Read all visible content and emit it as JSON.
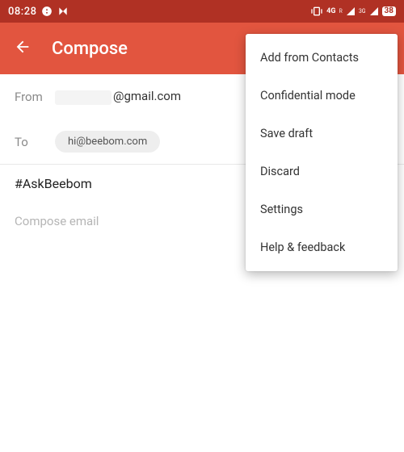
{
  "status": {
    "time": "08:28",
    "network_primary": "4G",
    "network_roaming": "R",
    "network_secondary": "3G",
    "battery_text": "38"
  },
  "appbar": {
    "title": "Compose"
  },
  "from": {
    "label": "From",
    "domain": "@gmail.com"
  },
  "to": {
    "label": "To",
    "chip": "hi@beebom.com"
  },
  "subject": "#AskBeebom",
  "body_placeholder": "Compose email",
  "menu": {
    "add_contacts": "Add from Contacts",
    "confidential": "Confidential mode",
    "save_draft": "Save draft",
    "discard": "Discard",
    "settings": "Settings",
    "help": "Help & feedback"
  }
}
